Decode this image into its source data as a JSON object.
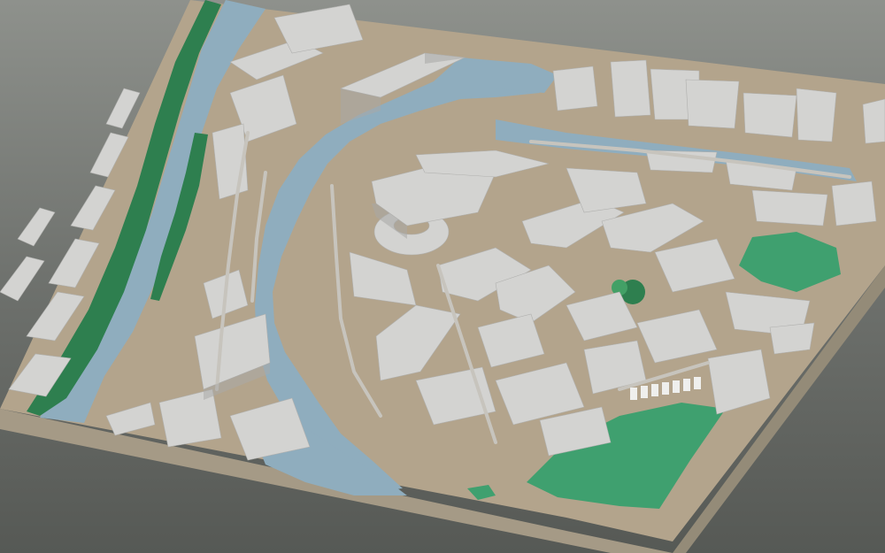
{
  "scene": {
    "kind": "3d-city-model",
    "view": "oblique aerial",
    "features": [
      "river",
      "canal",
      "buildings",
      "trees",
      "lawns",
      "roads",
      "terrain-base"
    ]
  },
  "colors": {
    "background_top": "#8e918c",
    "background_bottom": "#565955",
    "ground": "#b3a48c",
    "base_side": "#a59a86",
    "base_dark": "#8f8674",
    "water": "#8fadbe",
    "water_edge": "#7d9cae",
    "building_roof": "#d3d3d1",
    "building_side": "#bdbdbb",
    "building_dark": "#a9a9a7",
    "road": "#c7c4bd",
    "lawn": "#3fa06f",
    "tree": "#2e7f4f",
    "tree_light": "#43a066"
  }
}
